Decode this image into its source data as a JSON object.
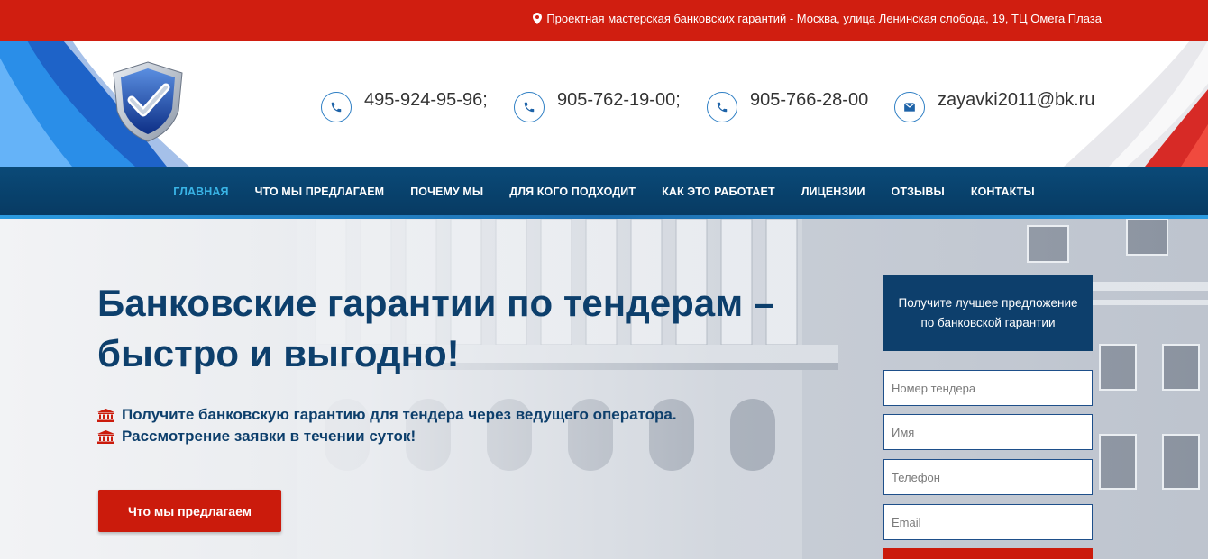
{
  "topbar": {
    "address": "Проектная мастерская банковских гарантий - Москва, улица Ленинская слобода, 19, ТЦ Омега Плаза"
  },
  "header": {
    "phones": [
      "495-924-95-96;",
      "905-762-19-00;",
      "905-766-28-00"
    ],
    "email": "zayavki2011@bk.ru"
  },
  "nav": {
    "items": [
      {
        "label": "ГЛАВНАЯ"
      },
      {
        "label": "ЧТО МЫ ПРЕДЛАГАЕМ"
      },
      {
        "label": "ПОЧЕМУ МЫ"
      },
      {
        "label": "ДЛЯ КОГО ПОДХОДИТ"
      },
      {
        "label": "КАК ЭТО РАБОТАЕТ"
      },
      {
        "label": "ЛИЦЕНЗИИ"
      },
      {
        "label": "ОТЗЫВЫ"
      },
      {
        "label": "КОНТАКТЫ"
      }
    ]
  },
  "hero": {
    "title_line1": "Банковские гарантии по тендерам –",
    "title_line2": "быстро и выгодно!",
    "bullets": [
      "Получите банковскую гарантию для тендера через ведущего оператора.",
      "Рассмотрение заявки в течении суток!"
    ],
    "cta_label": "Что мы предлагаем"
  },
  "form": {
    "heading": "Получите лучшее предложение по банковской гарантии",
    "tender_placeholder": "Номер тендера",
    "name_placeholder": "Имя",
    "phone_placeholder": "Телефон",
    "email_placeholder": "Email"
  },
  "colors": {
    "topbar": "#d01e10",
    "nav": "#0a4a78",
    "nav_active": "#39b4e6",
    "title": "#0d3f6c",
    "button": "#cb1b0c"
  },
  "icons": [
    "map-pin-icon",
    "shield-check-logo",
    "phone-icon",
    "envelope-icon",
    "bank-icon"
  ]
}
